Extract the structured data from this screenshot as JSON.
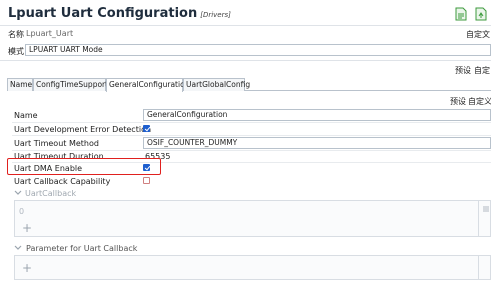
{
  "header": {
    "title": "Lpuart Uart Configuration",
    "subtitle": "[Drivers]"
  },
  "name_row": {
    "label": "名称",
    "value": "Lpuart_Uart",
    "right_text": "自定文"
  },
  "mode_row": {
    "label": "模式",
    "value": "LPUART UART Mode"
  },
  "preset_bar_1": {
    "preset": "预设",
    "custom": "自定"
  },
  "tabs": [
    {
      "label": "Name"
    },
    {
      "label": "ConfigTimeSupport"
    },
    {
      "label": "GeneralConfiguration"
    },
    {
      "label": "UartGlobalConfig"
    }
  ],
  "preset_bar_2": {
    "preset": "预设",
    "custom": "自定义("
  },
  "params": {
    "name": {
      "label": "Name",
      "value": "GeneralConfiguration"
    },
    "dev_error": {
      "label": "Uart Development Error Detection",
      "checked": true
    },
    "timeout_method": {
      "label": "Uart Timeout Method",
      "value": "OSIF_COUNTER_DUMMY"
    },
    "timeout_duration": {
      "label": "Uart Timeout Duration",
      "value": "65535"
    },
    "dma_enable": {
      "label": "Uart DMA Enable",
      "checked": true
    },
    "callback_cap": {
      "label": "Uart Callback Capability",
      "checked": false
    }
  },
  "groups": {
    "uart_callback": {
      "label": "UartCallback",
      "index": "0",
      "add": "+"
    },
    "param_callback": {
      "label": "Parameter for Uart Callback",
      "add": "+"
    }
  }
}
